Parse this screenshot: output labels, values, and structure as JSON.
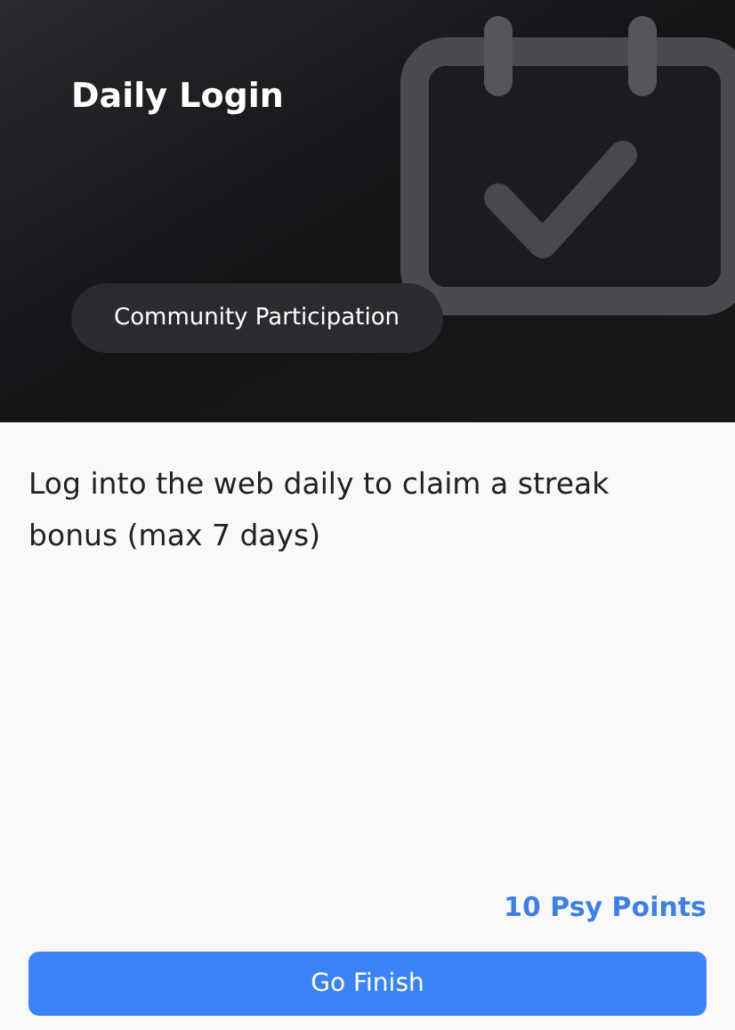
{
  "header": {
    "title": "Daily Login",
    "tag": "Community Participation"
  },
  "description": "Log into the web daily to claim a streak bonus (max 7 days)",
  "reward": "10 Psy Points",
  "button": "Go Finish"
}
